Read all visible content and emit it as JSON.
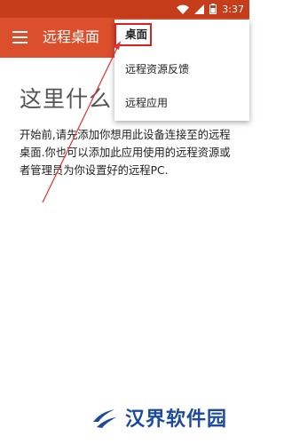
{
  "status_bar": {
    "time": "3:37",
    "bg": "#c63d1b"
  },
  "app_bar": {
    "title": "远程桌面",
    "bg": "#dc4f2c"
  },
  "empty_state": {
    "heading": "这里什么",
    "description": "开始前,请先添加你想用此设备连接至的远程桌面.你也可以添加此应用使用的远程资源或者管理员为你设置好的远程PC."
  },
  "dropdown": {
    "items": [
      {
        "label": "桌面",
        "highlighted": true
      },
      {
        "label": "远程资源反馈"
      },
      {
        "label": "远程应用"
      }
    ],
    "highlight_color": "#e02020"
  },
  "watermark": {
    "text": "汉界软件园",
    "color": "#1b4a9f"
  }
}
